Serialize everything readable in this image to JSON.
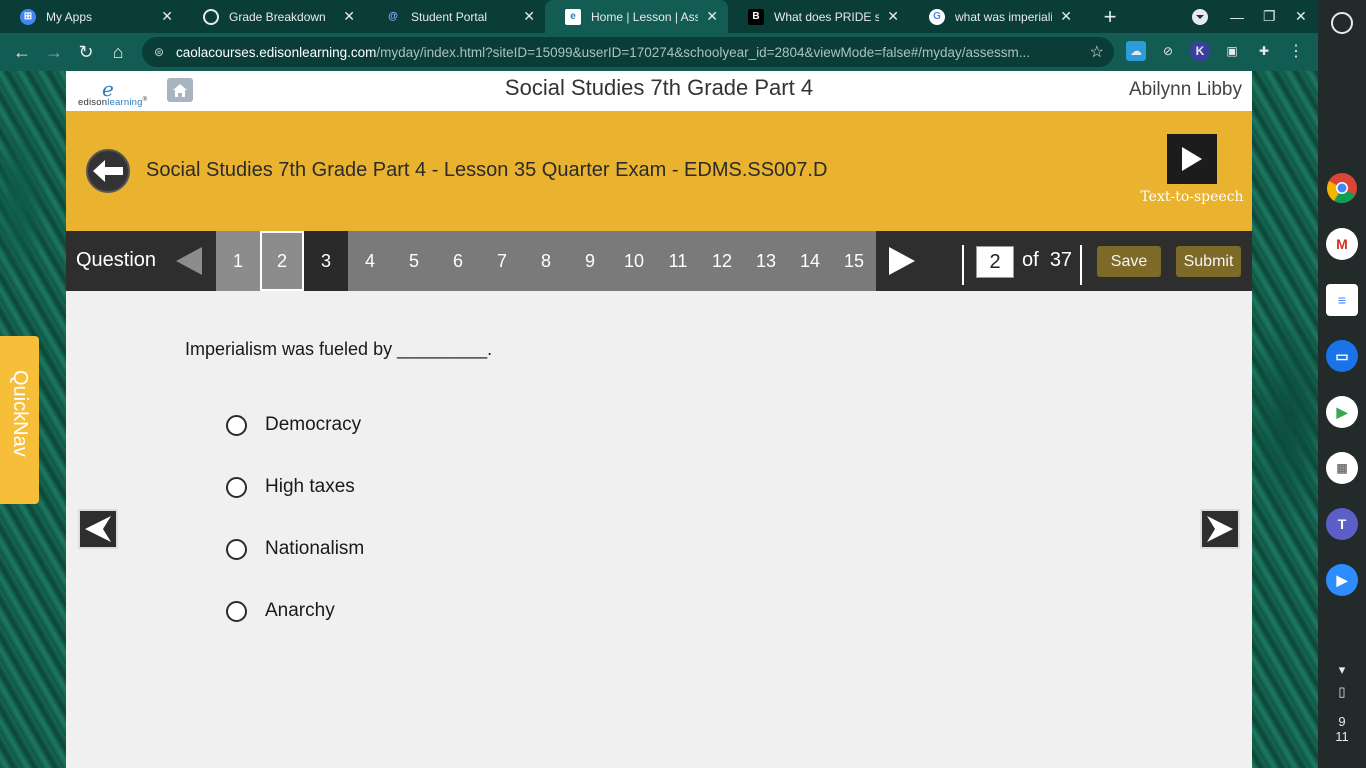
{
  "browser": {
    "tabs": [
      {
        "title": "My Apps",
        "favicon": "apps-icon",
        "active": false
      },
      {
        "title": "Grade Breakdown",
        "favicon": "globe-icon",
        "active": false
      },
      {
        "title": "Student Portal",
        "favicon": "portal-icon",
        "active": false
      },
      {
        "title": "Home | Lesson | Asse",
        "favicon": "edison-icon",
        "active": true
      },
      {
        "title": "What does PRIDE star",
        "favicon": "b-icon",
        "active": false
      },
      {
        "title": "what was imperialism",
        "favicon": "google-icon",
        "active": false
      }
    ],
    "new_tab": "+",
    "url_host": "caolacourses.edisonlearning.com",
    "url_path": "/myday/index.html?siteID=15099&userID=170274&schoolyear_id=2804&viewMode=false#/myday/assessm..."
  },
  "header": {
    "course_title": "Social Studies 7th Grade Part 4",
    "student_name": "Abilynn Libby",
    "logo_mark": "e",
    "logo_text_a": "edison",
    "logo_text_b": "learning",
    "logo_tm": "®"
  },
  "lesson": {
    "title": "Social Studies 7th Grade Part 4 - Lesson 35 Quarter Exam - EDMS.SS007.D",
    "tts_label": "Text-to-speech"
  },
  "question_nav": {
    "label": "Question",
    "numbers": [
      "1",
      "2",
      "3",
      "4",
      "5",
      "6",
      "7",
      "8",
      "9",
      "10",
      "11",
      "12",
      "13",
      "14",
      "15"
    ],
    "current": "2",
    "of_label": "of",
    "total": "37",
    "save_label": "Save",
    "submit_label": "Submit"
  },
  "question": {
    "text": "Imperialism was fueled by _________.",
    "options": [
      "Democracy",
      "High taxes",
      "Nationalism",
      "Anarchy"
    ]
  },
  "quicknav": {
    "label": "QuickNav"
  },
  "shelf": {
    "apps": [
      "chrome-icon",
      "gmail-icon",
      "docs-icon",
      "files-icon",
      "play-store-icon",
      "apps-grid-icon",
      "teams-icon",
      "zoom-icon"
    ],
    "time_hour": "9",
    "time_min": "11"
  },
  "colors": {
    "lesson_bar": "#e9b22f",
    "nav_bar": "#2e2e2e",
    "button_bg": "#7d6a28",
    "quicknav": "#f7be3a"
  }
}
